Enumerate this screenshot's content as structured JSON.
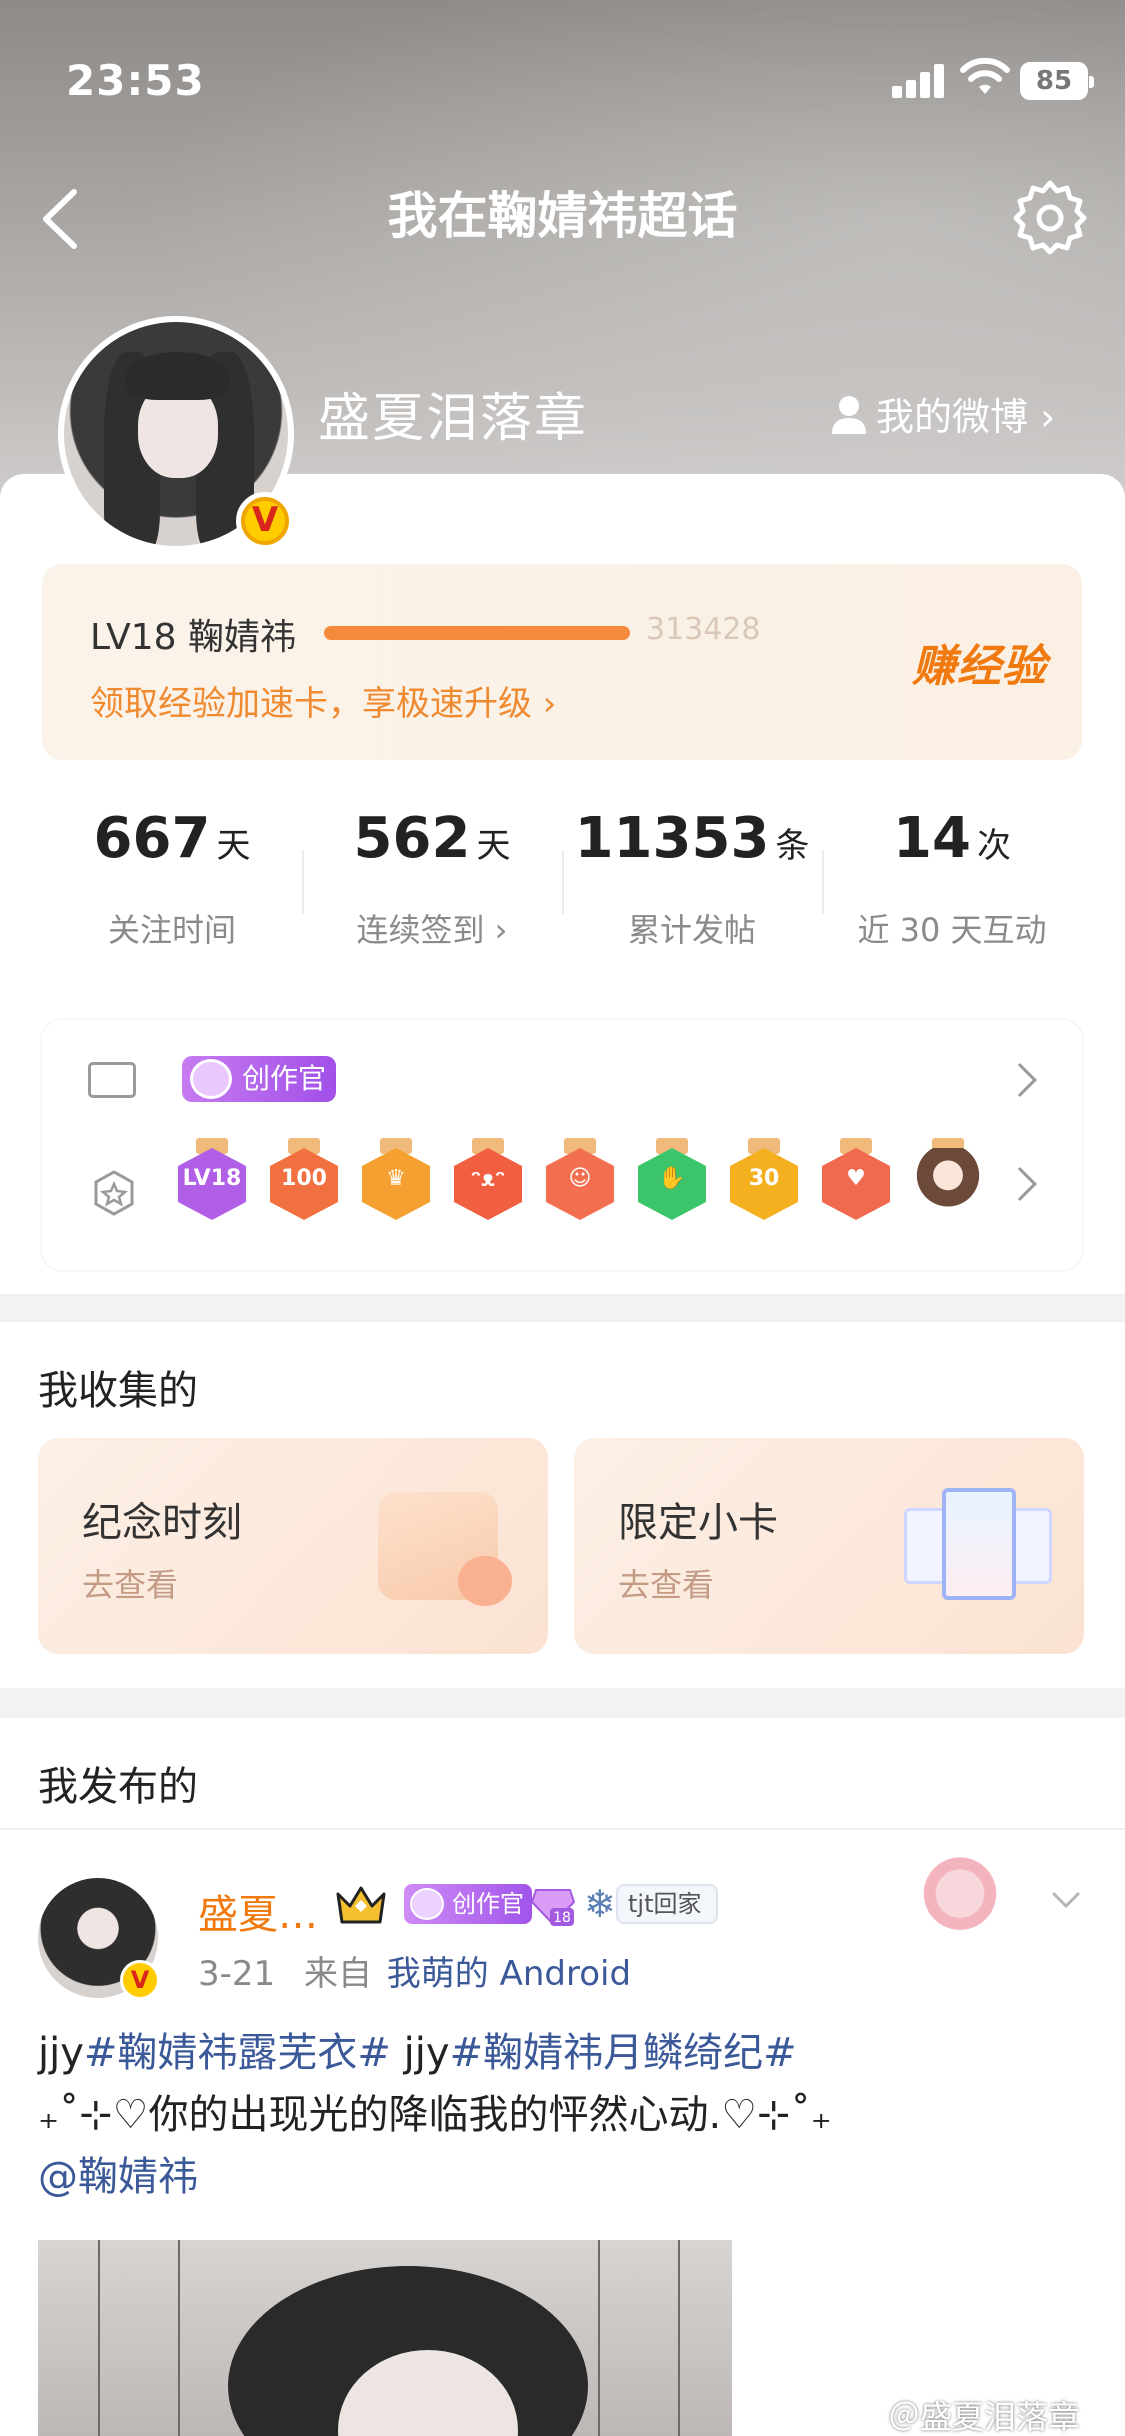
{
  "status_bar": {
    "time": "23:53",
    "battery": "85"
  },
  "nav": {
    "title": "我在鞠婧祎超话"
  },
  "profile": {
    "username": "盛夏泪落章",
    "my_weibo": "我的微博 ›",
    "verified_mark": "V"
  },
  "level": {
    "label": "LV18 鞠婧祎",
    "progress_fraction": 1.0,
    "points": "313428",
    "promo": "领取经验加速卡，享极速升级 ›",
    "earn": "赚经验"
  },
  "stats": [
    {
      "value": "667",
      "unit": "天",
      "label": "关注时间"
    },
    {
      "value": "562",
      "unit": "天",
      "label": "连续签到 ›"
    },
    {
      "value": "11353",
      "unit": "条",
      "label": "累计发帖"
    },
    {
      "value": "14",
      "unit": "次",
      "label": "近 30 天互动"
    }
  ],
  "badges": {
    "creator_tag": "创作官",
    "medals": [
      {
        "name": "lv18-medal",
        "glyph": "LV18",
        "color": "#b05fe6"
      },
      {
        "name": "100-days-medal",
        "glyph": "100",
        "color": "#f07040"
      },
      {
        "name": "crown-medal",
        "glyph": "♛",
        "color": "#f5a030"
      },
      {
        "name": "cat-medal",
        "glyph": "ᵔᴥᵔ",
        "color": "#f06040"
      },
      {
        "name": "mascot-medal",
        "glyph": "☺",
        "color": "#f27050"
      },
      {
        "name": "hand-medal",
        "glyph": "✋",
        "color": "#3cc46a"
      },
      {
        "name": "30-days-medal",
        "glyph": "30",
        "color": "#f5b020"
      },
      {
        "name": "heart-hand-medal",
        "glyph": "♥",
        "color": "#f06a50"
      },
      {
        "name": "girl-medal",
        "glyph": "",
        "color": "#f0c090"
      }
    ]
  },
  "collections": {
    "title": "我收集的",
    "cards": [
      {
        "title": "纪念时刻",
        "sub": "去查看"
      },
      {
        "title": "限定小卡",
        "sub": "去查看"
      }
    ]
  },
  "posts": {
    "title": "我发布的",
    "item": {
      "name": "盛夏…",
      "creator_tag": "创作官",
      "gem_level": "18",
      "fan_tag": "tjt回家",
      "date": "3-21",
      "from": "来自",
      "source": "我萌的 Android",
      "line1_a": "jjy",
      "tag1": "#鞠婧祎露芜衣#",
      "line1_b": " jjy",
      "tag2": "#鞠婧祎月鳞绮纪#",
      "line2": "₊˚⊹♡你的出现光的降临我的怦然心动.♡⊹˚₊",
      "mention": "@鞠婧祎"
    }
  },
  "watermark": "＠盛夏泪落章"
}
